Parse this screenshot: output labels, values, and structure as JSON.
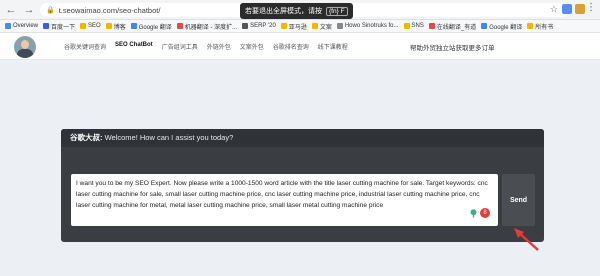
{
  "browser": {
    "url": "t.seowaimao.com/seo-chatbot/",
    "toast_text": "若要退出全屏模式，请按",
    "toast_key": "{fn} F"
  },
  "bookmarks": [
    {
      "label": "Overview",
      "color": "#4a8af4"
    },
    {
      "label": "百度一下",
      "color": "#3b5cf0"
    },
    {
      "label": "SEO",
      "color": "#f5b400"
    },
    {
      "label": "博客",
      "color": "#f5b400"
    },
    {
      "label": "Google 翻译",
      "color": "#4285f4"
    },
    {
      "label": "机器翻译 - 深度扩...",
      "color": "#e34b4b"
    },
    {
      "label": "SERP '20",
      "color": "#555"
    },
    {
      "label": "亚马逊",
      "color": "#f5b400"
    },
    {
      "label": "文案",
      "color": "#f5b400"
    },
    {
      "label": "Howo Sinotruks fo...",
      "color": "#888"
    },
    {
      "label": "SNS",
      "color": "#f5b400"
    },
    {
      "label": "在线翻译_有道",
      "color": "#e34b4b"
    },
    {
      "label": "Google 翻译",
      "color": "#4285f4"
    },
    {
      "label": "所有书",
      "color": "#f5b400"
    }
  ],
  "site_nav": {
    "items": [
      "谷歌关键词查询",
      "SEO ChatBot",
      "广告组词工具",
      "外链外包",
      "文案外包",
      "谷歌排名查询",
      "线下课教程"
    ],
    "active_index": 1,
    "promo": "帮助外贸独立站获取更多订单"
  },
  "chat": {
    "greeting_label": "谷歌大叔:",
    "greeting_text": "Welcome! How can I assist you today?",
    "input_value": "I want you to be my SEO Expert. Now please write a 1000-1500 word article with the title laser cutting machine for sale. Target keywords: cnc laser cutting machine for sale, small laser cutting machine price, cnc laser cutting machine price, industrial laser cutting machine price, cnc laser cutting machine for metal, metal laser cutting machine price, small laser metal cutting machine price",
    "send_label": "Send",
    "badge": "8"
  }
}
